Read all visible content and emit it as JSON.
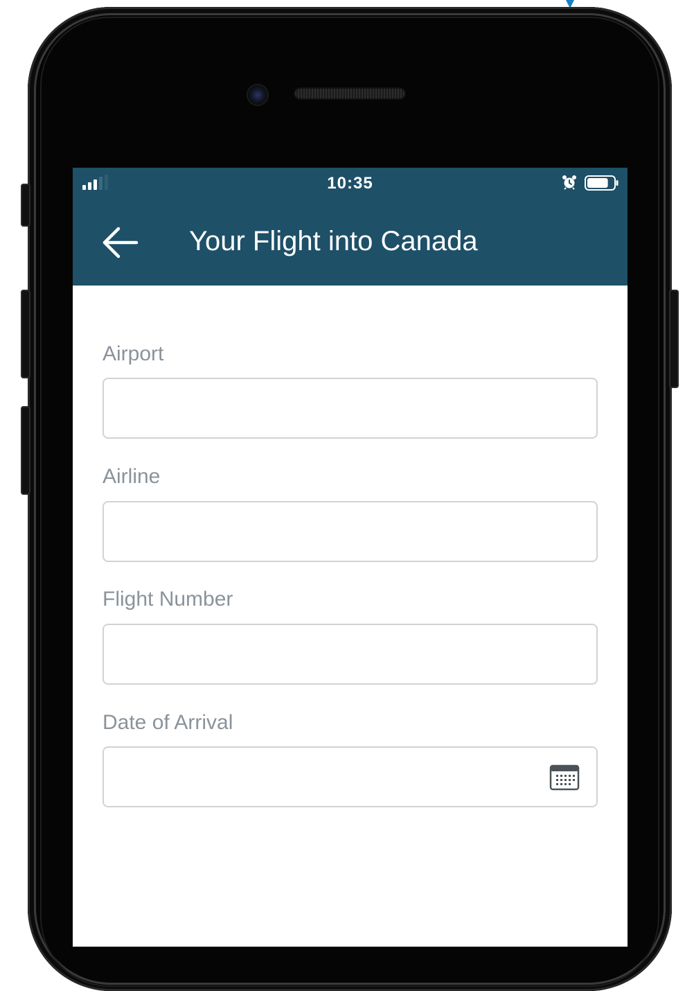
{
  "status_bar": {
    "time": "10:35",
    "signal_icon": "signal-strength-icon",
    "alarm_icon": "alarm-clock-icon",
    "battery_icon": "battery-icon",
    "battery_level": 0.8
  },
  "app_bar": {
    "back_icon": "arrow-left-icon",
    "title": "Your Flight into Canada"
  },
  "form": {
    "airport": {
      "label": "Airport",
      "value": "",
      "placeholder": ""
    },
    "airline": {
      "label": "Airline",
      "value": "",
      "placeholder": ""
    },
    "flight_number": {
      "label": "Flight Number",
      "value": "",
      "placeholder": ""
    },
    "date_of_arrival": {
      "label": "Date of Arrival",
      "value": "",
      "placeholder": "",
      "icon": "calendar-icon"
    }
  },
  "colors": {
    "header_bg": "#1e5068",
    "header_text": "#ffffff",
    "label_text": "#8a939a",
    "input_border": "#cfd3d6",
    "device_body": "#050505"
  }
}
